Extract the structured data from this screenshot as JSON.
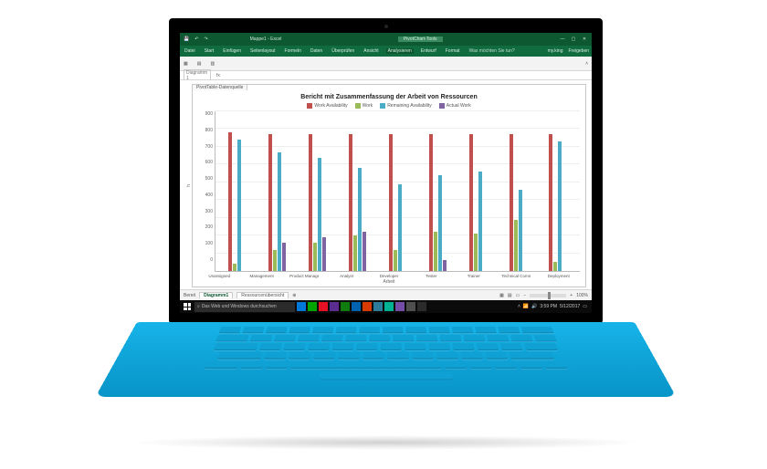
{
  "app": {
    "filename": "Mappe1 - Excel",
    "context_tab": "PivotChart-Tools",
    "account": "my.king",
    "share": "Freigeben"
  },
  "ribbon": {
    "tabs": [
      "Datei",
      "Start",
      "Einfügen",
      "Seitenlayout",
      "Formeln",
      "Daten",
      "Überprüfen",
      "Ansicht"
    ],
    "context_tabs": [
      "Analysieren",
      "Entwurf",
      "Format"
    ],
    "tell_me": "Was möchten Sie tun?"
  },
  "formula": {
    "namebox": "Diagramm 1",
    "fx": "fx"
  },
  "chart_panel": {
    "tab": "PivotTable-Datenquelle"
  },
  "chart_data": {
    "type": "bar",
    "title": "Bericht mit Zusammenfassung der Arbeit von Ressourcen",
    "xlabel": "Arbeit",
    "ylabel": "h",
    "ylim": [
      0,
      900
    ],
    "yticks": [
      0,
      100,
      200,
      300,
      400,
      500,
      600,
      700,
      800,
      900
    ],
    "categories": [
      "Unassigned",
      "Management",
      "Product Manager",
      "Analyst",
      "Developer",
      "Tester",
      "Trainer",
      "Technical Communicator",
      "Deployment"
    ],
    "series": [
      {
        "name": "Work Availability",
        "color": "#c0504d",
        "values": [
          780,
          770,
          770,
          770,
          770,
          770,
          770,
          770,
          770
        ]
      },
      {
        "name": "Work",
        "color": "#9bbb59",
        "values": [
          40,
          120,
          160,
          200,
          120,
          220,
          210,
          290,
          50
        ]
      },
      {
        "name": "Remaining Availability",
        "color": "#4bacc6",
        "values": [
          740,
          670,
          640,
          580,
          490,
          540,
          560,
          460,
          730
        ]
      },
      {
        "name": "Actual Work",
        "color": "#8064a2",
        "values": [
          0,
          160,
          190,
          220,
          0,
          60,
          0,
          0,
          0
        ]
      }
    ]
  },
  "sheet_tabs": {
    "active": "Diagramm1",
    "others": [
      "Ressourcenübersicht"
    ],
    "zoom": "100%"
  },
  "status": {
    "mode": "Bereit"
  },
  "taskbar": {
    "search_placeholder": "Das Web und Windows durchsuchen",
    "time": "3:59 PM",
    "date": "5/12/2017",
    "app_colors": [
      "#0078d7",
      "#00a300",
      "#e81123",
      "#5b2d90",
      "#107c10",
      "#0063b1",
      "#d83b01",
      "#2d7d9a",
      "#00b294",
      "#744da9",
      "#4f4f4f",
      "#2b2b2b"
    ]
  }
}
